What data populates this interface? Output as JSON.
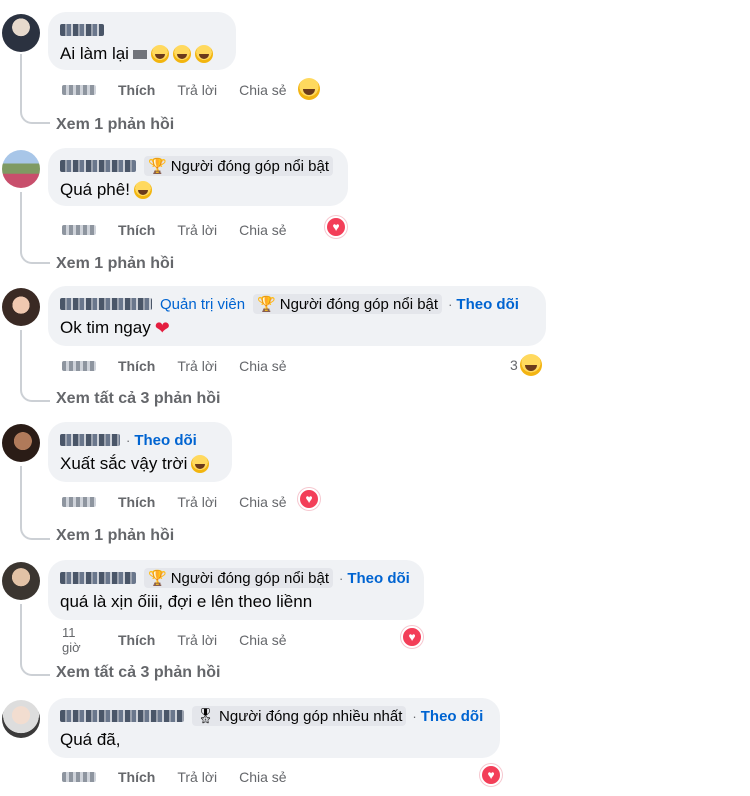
{
  "comments": [
    {
      "text": "Ai làm lại",
      "actions": {
        "like": "Thích",
        "reply": "Trả lời",
        "share": "Chia sẻ"
      },
      "reaction": "haha",
      "view_replies": "Xem 1 phản hồi"
    },
    {
      "badge": "Người đóng góp nổi bật",
      "text": "Quá phê!",
      "actions": {
        "like": "Thích",
        "reply": "Trả lời",
        "share": "Chia sẻ"
      },
      "reaction": "love",
      "view_replies": "Xem 1 phản hồi"
    },
    {
      "role": "Quản trị viên",
      "badge": "Người đóng góp nổi bật",
      "follow": "Theo dõi",
      "text": "Ok tim ngay",
      "actions": {
        "like": "Thích",
        "reply": "Trả lời",
        "share": "Chia sẻ"
      },
      "reaction_count": "3",
      "reaction": "haha",
      "view_replies": "Xem tất cả 3 phản hồi"
    },
    {
      "follow": "Theo dõi",
      "text": "Xuất sắc vậy trời",
      "actions": {
        "like": "Thích",
        "reply": "Trả lời",
        "share": "Chia sẻ"
      },
      "reaction": "love",
      "view_replies": "Xem 1 phản hồi"
    },
    {
      "badge": "Người đóng góp nổi bật",
      "follow": "Theo dõi",
      "text": "quá là xịn ốiii, đợi e lên theo liềnn",
      "time": "11 giờ",
      "actions": {
        "like": "Thích",
        "reply": "Trả lời",
        "share": "Chia sẻ"
      },
      "reaction": "love",
      "view_replies": "Xem tất cả 3 phản hồi"
    },
    {
      "badge": "Người đóng góp nhiều nhất",
      "follow": "Theo dõi",
      "text": "Quá đã,",
      "actions": {
        "like": "Thích",
        "reply": "Trả lời",
        "share": "Chia sẻ"
      },
      "reaction": "love"
    }
  ],
  "separator": "·",
  "icons": {
    "trophy": "trophy-icon",
    "medal": "medal-icon"
  },
  "colors": {
    "link": "#0064d1",
    "bubble": "#f0f2f5",
    "muted": "#65676b",
    "love": "#f33e58"
  }
}
